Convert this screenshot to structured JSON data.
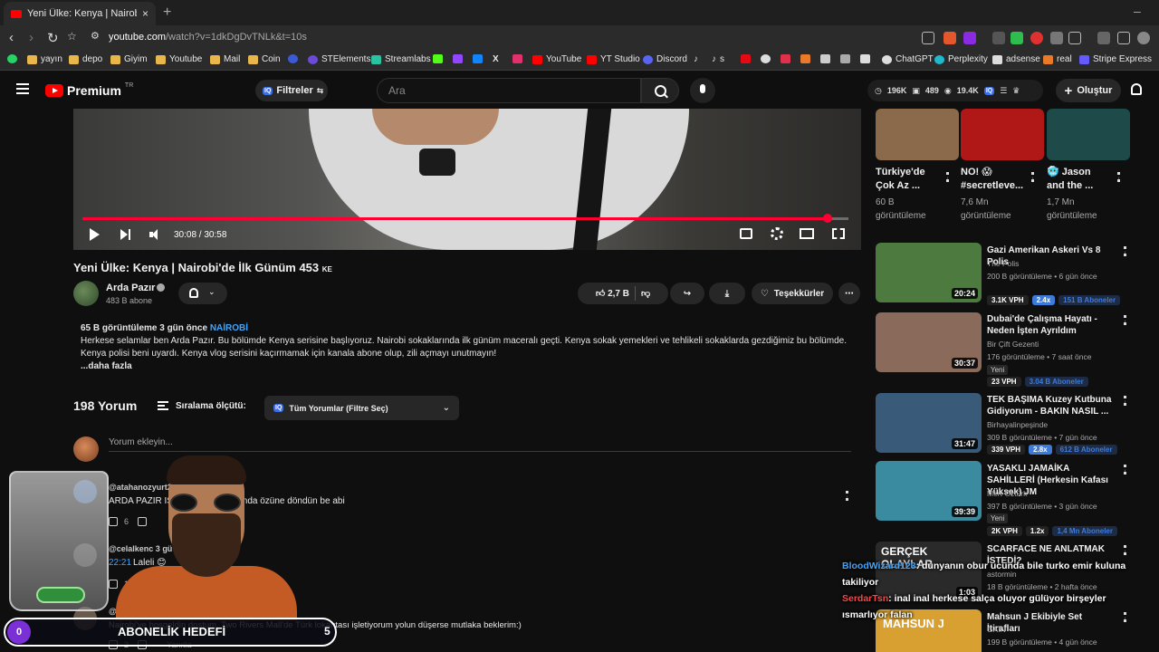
{
  "browser": {
    "tab_title": "Yeni Ülke: Kenya | Nairobi'de İlk",
    "url_host": "youtube.com",
    "url_rest": "/watch?v=1dkDgDvTNLk&t=10s",
    "bookmarks": [
      "yayın",
      "depo",
      "Giyim",
      "Youtube",
      "Mail",
      "Coin",
      "STElements",
      "Streamlabs",
      "YouTube",
      "YT Studio",
      "Discord",
      "s",
      "ChatGPT",
      "Perplexity",
      "adsense",
      "real",
      "Stripe Express"
    ]
  },
  "header": {
    "logo": "Premium",
    "logo_tr": "TR",
    "filters_label": "Filtreler",
    "search_placeholder": "Ara",
    "stat_views": "196K",
    "stat_videos": "489",
    "stat_subs": "19.4K",
    "create_label": "Oluştur"
  },
  "player": {
    "time": "30:08 / 30:58",
    "progress": 0.973
  },
  "video": {
    "title": "Yeni Ülke: Kenya | Nairobi'de İlk Günüm 453",
    "title_suffix": "KE",
    "channel": "Arda Pazır",
    "subs": "483 B abone",
    "likes": "2,7 B",
    "thanks_label": "Teşekkürler"
  },
  "description": {
    "meta": "65 B görüntüleme  3 gün önce",
    "tag": "NAİROBİ",
    "text": "Herkese selamlar ben Arda Pazır. Bu bölümde Kenya serisine başlıyoruz. Nairobi sokaklarında ilk günüm maceralı geçti. Kenya sokak yemekleri ve tehlikeli sokaklarda gezdiğimiz bu bölümde. Kenya polisi beni uyardı. Kenya vlog serisini kaçırmamak için kanala abone olup, zili açmayı unutmayın!",
    "more": "...daha fazla"
  },
  "comments": {
    "count": "198 Yorum",
    "sort_label": "Sıralama ölçütü:",
    "filter_label": "Tüm Yorumlar (Filtre Seç)",
    "add_placeholder": "Yorum ekleyin...",
    "items": [
      {
        "author": "@atahanozyurt2",
        "text": "ARDA PAZIR IS",
        "text2": "ında özüne döndün be abi",
        "likes": "6"
      },
      {
        "author": "@celalkenc 3 gü",
        "time": "22:21",
        "text": "Laleli 😊",
        "likes": "12"
      },
      {
        "author": "@e",
        "text": "Nairobi'ye hoşgeldin dostum. Two Rivers Mall'de Türk lokantası işletiyorum yolun düşerse mutlaka beklerim:)",
        "likes": "2",
        "reply": "Yanıtla"
      }
    ]
  },
  "sidebar": {
    "shelf": [
      {
        "title": "Türkiye'de Çok Az ...",
        "views": "60 B görüntüleme",
        "color": "#8a6a4a"
      },
      {
        "title": "NO! 😱 #secretleve...",
        "views": "7,6 Mn görüntüleme",
        "color": "#b01818"
      },
      {
        "title": "🥶 Jason and the ...",
        "views": "1,7 Mn görüntüleme",
        "color": "#1f4a4a"
      }
    ],
    "recs": [
      {
        "title": "Gazi Amerikan Askeri Vs 8 Polis",
        "channel": "The Polis",
        "meta": "200 B görüntüleme • 6 gün önce",
        "duration": "20:24",
        "vph": "3.1K VPH",
        "mult": "2.4x",
        "subs": "151 B Aboneler",
        "color": "#4d7a3e",
        "new": ""
      },
      {
        "title": "Dubai'de Çalışma Hayatı - Neden İşten Ayrıldım",
        "channel": "Bir Çift Gezenti",
        "meta": "176 görüntüleme • 7 saat önce",
        "duration": "30:37",
        "vph": "23 VPH",
        "mult": "",
        "subs": "3.04 B Aboneler",
        "color": "#8a6a5a",
        "new": "Yeni"
      },
      {
        "title": "TEK BAŞIMA Kuzey Kutbuna Gidiyorum - BAKIN NASIL ...",
        "channel": "Birhayalinpeşinde",
        "meta": "309 B görüntüleme • 7 gün önce",
        "duration": "31:47",
        "vph": "339 VPH",
        "mult": "2.8x",
        "subs": "612 B Aboneler",
        "color": "#3a5a7a",
        "new": ""
      },
      {
        "title": "YASAKLI JAMAİKA SAHİLLERİ (Herkesin Kafası Yüksek) JM",
        "channel": "Mert Öztürk",
        "meta": "397 B görüntüleme • 3 gün önce",
        "duration": "39:39",
        "vph": "2K VPH",
        "mult": "1.2x",
        "subs": "1,4 Mn Aboneler",
        "color": "#3a8aa0",
        "new": "Yeni"
      },
      {
        "title": "SCARFACE NE ANLATMAK İSTEDİ?",
        "channel": "astormin",
        "meta": "18 B görüntüleme • 2 hafta önce",
        "duration": "1:03",
        "color": "#2a2a2a",
        "thumb_text": "GERÇEK OLAYLAR"
      },
      {
        "title": "Mahsun J Ekibiyle Set İtirafları",
        "channel": "GAİN",
        "meta": "199 B görüntüleme • 4 gün önce",
        "color": "#d8a030",
        "thumb_text": "MAHSUN J"
      }
    ]
  },
  "chat": {
    "m1_user": "BloodWizard123",
    "m1_text": ": dunyanın obur ucunda bile turko emir kuluna takiliyor",
    "m2_user": "SerdarTsn",
    "m2_text": ": inal inal herkese salça oluyor gülüyor birşeyler ısmarlıyor falan"
  },
  "sub_goal": {
    "current": "0",
    "label": "ABONELİK HEDEFİ",
    "target": "5"
  }
}
